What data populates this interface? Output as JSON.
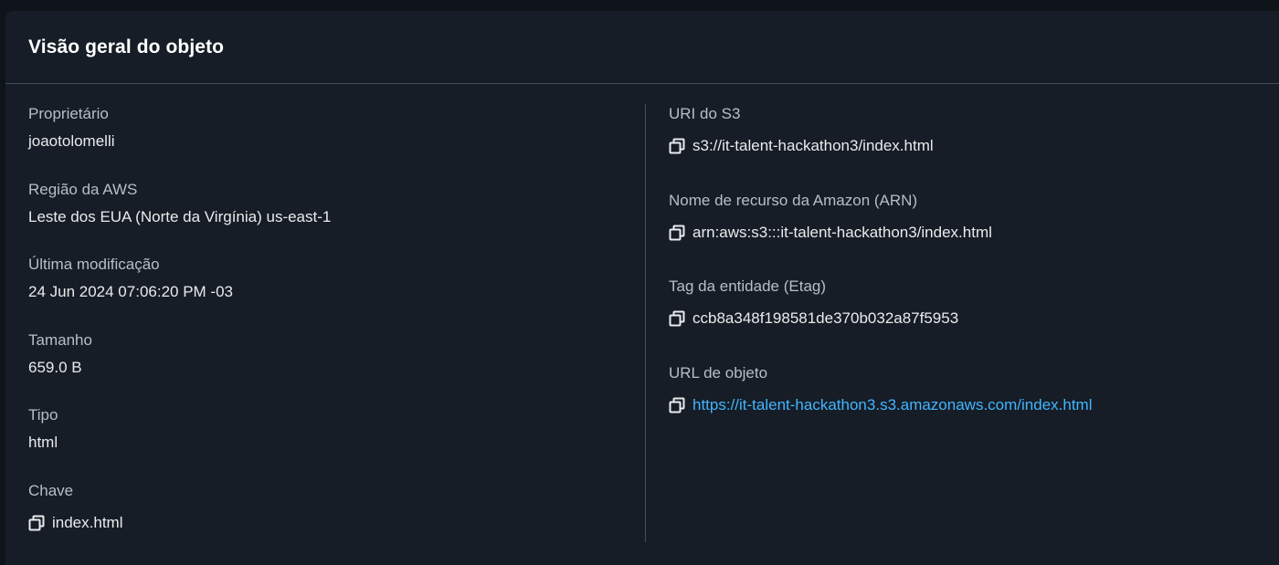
{
  "panel": {
    "title": "Visão geral do objeto"
  },
  "left": {
    "owner": {
      "label": "Proprietário",
      "value": "joaotolomelli"
    },
    "region": {
      "label": "Região da AWS",
      "value": "Leste dos EUA (Norte da Virgínia) us-east-1"
    },
    "last_modified": {
      "label": "Última modificação",
      "value": "24 Jun 2024 07:06:20 PM -03"
    },
    "size": {
      "label": "Tamanho",
      "value": "659.0 B"
    },
    "type": {
      "label": "Tipo",
      "value": "html"
    },
    "key": {
      "label": "Chave",
      "value": "index.html"
    }
  },
  "right": {
    "s3_uri": {
      "label": "URI do S3",
      "value": "s3://it-talent-hackathon3/index.html"
    },
    "arn": {
      "label": "Nome de recurso da Amazon (ARN)",
      "value": "arn:aws:s3:::it-talent-hackathon3/index.html"
    },
    "etag": {
      "label": "Tag da entidade (Etag)",
      "value": "ccb8a348f198581de370b032a87f5953"
    },
    "object_url": {
      "label": "URL de objeto",
      "value": "https://it-talent-hackathon3.s3.amazonaws.com/index.html"
    }
  },
  "icons": {
    "copy": "copy-icon"
  },
  "colors": {
    "panel_bg": "#161d26",
    "page_bg": "#0f141a",
    "label": "#b6bec9",
    "value": "#e9ebed",
    "link": "#42b4ff",
    "divider": "#414d5c"
  }
}
